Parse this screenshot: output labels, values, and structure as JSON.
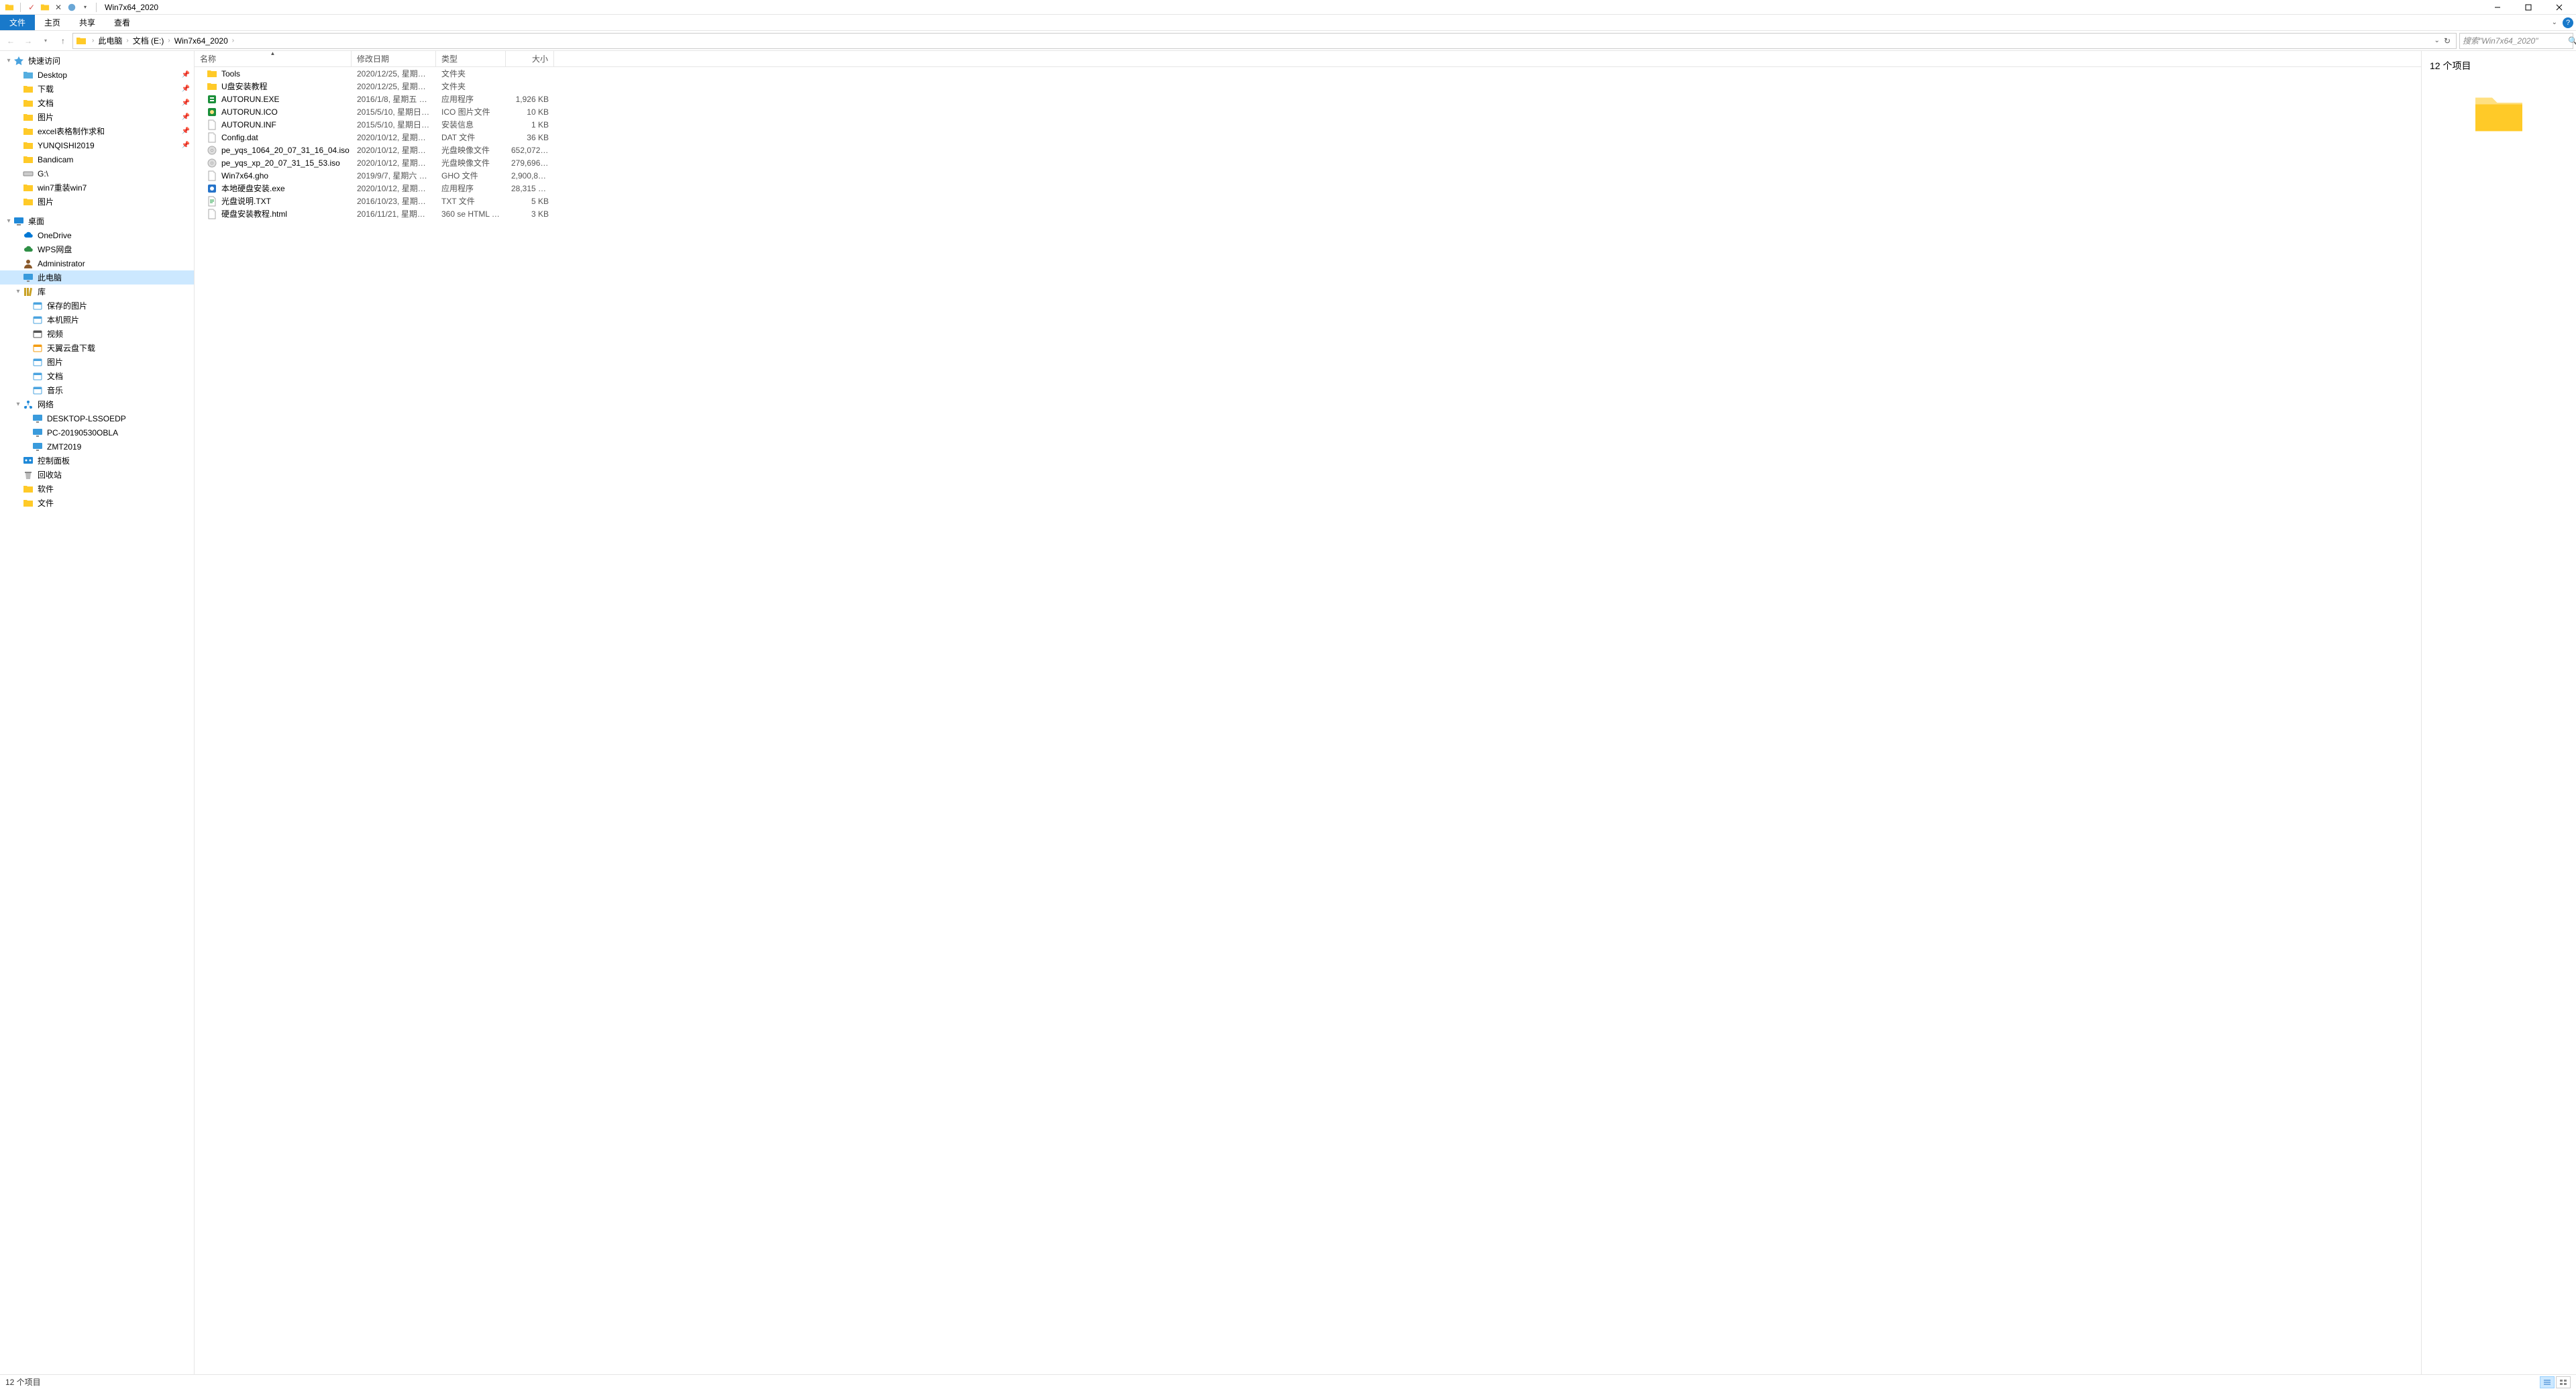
{
  "window": {
    "title": "Win7x64_2020",
    "min": "—",
    "max": "▭",
    "close": "✕"
  },
  "ribbon": {
    "tabs": [
      "文件",
      "主页",
      "共享",
      "查看"
    ]
  },
  "breadcrumb": [
    "此电脑",
    "文档 (E:)",
    "Win7x64_2020"
  ],
  "search": {
    "placeholder": "搜索\"Win7x64_2020\""
  },
  "columns": {
    "name": "名称",
    "date": "修改日期",
    "type": "类型",
    "size": "大小"
  },
  "sidebar": [
    {
      "label": "快速访问",
      "indent": 1,
      "icon": "star",
      "color": "#4aa3df",
      "chev": "▾"
    },
    {
      "label": "Desktop",
      "indent": 2,
      "icon": "folder",
      "color": "#55aee0",
      "pin": true
    },
    {
      "label": "下载",
      "indent": 2,
      "icon": "folder",
      "color": "#ffca28",
      "pin": true
    },
    {
      "label": "文档",
      "indent": 2,
      "icon": "folder",
      "color": "#ffca28",
      "pin": true
    },
    {
      "label": "图片",
      "indent": 2,
      "icon": "folder",
      "color": "#ffca28",
      "pin": true
    },
    {
      "label": "excel表格制作求和",
      "indent": 2,
      "icon": "folder",
      "color": "#ffca28",
      "pin": true
    },
    {
      "label": "YUNQISHI2019",
      "indent": 2,
      "icon": "folder",
      "color": "#ffca28",
      "pin": true
    },
    {
      "label": "Bandicam",
      "indent": 2,
      "icon": "folder",
      "color": "#ffca28"
    },
    {
      "label": "G:\\",
      "indent": 2,
      "icon": "drive",
      "color": "#888"
    },
    {
      "label": "win7重装win7",
      "indent": 2,
      "icon": "folder",
      "color": "#ffca28"
    },
    {
      "label": "图片",
      "indent": 2,
      "icon": "folder",
      "color": "#ffca28"
    },
    {
      "label": "桌面",
      "indent": 1,
      "icon": "desktop",
      "color": "#2089d8",
      "chev": "▾",
      "gapBefore": true
    },
    {
      "label": "OneDrive",
      "indent": 2,
      "icon": "cloud",
      "color": "#0078d4"
    },
    {
      "label": "WPS网盘",
      "indent": 2,
      "icon": "cloud",
      "color": "#2f8f46"
    },
    {
      "label": "Administrator",
      "indent": 2,
      "icon": "user",
      "color": "#8b5a2b"
    },
    {
      "label": "此电脑",
      "indent": 2,
      "icon": "pc",
      "color": "#3a9bdc",
      "selected": true
    },
    {
      "label": "库",
      "indent": 2,
      "icon": "library",
      "color": "#c9a227",
      "chev": "▾"
    },
    {
      "label": "保存的图片",
      "indent": 3,
      "icon": "lib",
      "color": "#4aa3df"
    },
    {
      "label": "本机照片",
      "indent": 3,
      "icon": "lib",
      "color": "#4aa3df"
    },
    {
      "label": "视频",
      "indent": 3,
      "icon": "lib",
      "color": "#555"
    },
    {
      "label": "天翼云盘下载",
      "indent": 3,
      "icon": "lib",
      "color": "#f39c12"
    },
    {
      "label": "图片",
      "indent": 3,
      "icon": "lib",
      "color": "#4aa3df"
    },
    {
      "label": "文档",
      "indent": 3,
      "icon": "lib",
      "color": "#4aa3df"
    },
    {
      "label": "音乐",
      "indent": 3,
      "icon": "lib",
      "color": "#4aa3df"
    },
    {
      "label": "网络",
      "indent": 2,
      "icon": "network",
      "color": "#2089d8",
      "chev": "▾"
    },
    {
      "label": "DESKTOP-LSSOEDP",
      "indent": 3,
      "icon": "pc",
      "color": "#3a9bdc"
    },
    {
      "label": "PC-20190530OBLA",
      "indent": 3,
      "icon": "pc",
      "color": "#3a9bdc"
    },
    {
      "label": "ZMT2019",
      "indent": 3,
      "icon": "pc",
      "color": "#3a9bdc"
    },
    {
      "label": "控制面板",
      "indent": 2,
      "icon": "control",
      "color": "#2089d8"
    },
    {
      "label": "回收站",
      "indent": 2,
      "icon": "recycle",
      "color": "#888"
    },
    {
      "label": "软件",
      "indent": 2,
      "icon": "folder",
      "color": "#ffca28"
    },
    {
      "label": "文件",
      "indent": 2,
      "icon": "folder",
      "color": "#ffca28"
    }
  ],
  "files": [
    {
      "name": "Tools",
      "date": "2020/12/25, 星期五 1...",
      "type": "文件夹",
      "size": "",
      "icon": "folder",
      "color": "#ffca28"
    },
    {
      "name": "U盘安装教程",
      "date": "2020/12/25, 星期五 1...",
      "type": "文件夹",
      "size": "",
      "icon": "folder",
      "color": "#ffca28"
    },
    {
      "name": "AUTORUN.EXE",
      "date": "2016/1/8, 星期五 04:...",
      "type": "应用程序",
      "size": "1,926 KB",
      "icon": "exe",
      "color": "#1b8f3a"
    },
    {
      "name": "AUTORUN.ICO",
      "date": "2015/5/10, 星期日 02...",
      "type": "ICO 图片文件",
      "size": "10 KB",
      "icon": "ico",
      "color": "#1b8f3a"
    },
    {
      "name": "AUTORUN.INF",
      "date": "2015/5/10, 星期日 02...",
      "type": "安装信息",
      "size": "1 KB",
      "icon": "inf",
      "color": "#888"
    },
    {
      "name": "Config.dat",
      "date": "2020/10/12, 星期一 1...",
      "type": "DAT 文件",
      "size": "36 KB",
      "icon": "file",
      "color": "#888"
    },
    {
      "name": "pe_yqs_1064_20_07_31_16_04.iso",
      "date": "2020/10/12, 星期一 1...",
      "type": "光盘映像文件",
      "size": "652,072 KB",
      "icon": "iso",
      "color": "#888"
    },
    {
      "name": "pe_yqs_xp_20_07_31_15_53.iso",
      "date": "2020/10/12, 星期一 1...",
      "type": "光盘映像文件",
      "size": "279,696 KB",
      "icon": "iso",
      "color": "#888"
    },
    {
      "name": "Win7x64.gho",
      "date": "2019/9/7, 星期六 19:...",
      "type": "GHO 文件",
      "size": "2,900,813...",
      "icon": "file",
      "color": "#888"
    },
    {
      "name": "本地硬盘安装.exe",
      "date": "2020/10/12, 星期一 1...",
      "type": "应用程序",
      "size": "28,315 KB",
      "icon": "exe2",
      "color": "#2573c9"
    },
    {
      "name": "光盘说明.TXT",
      "date": "2016/10/23, 星期日 0...",
      "type": "TXT 文件",
      "size": "5 KB",
      "icon": "txt",
      "color": "#2ea44f"
    },
    {
      "name": "硬盘安装教程.html",
      "date": "2016/11/21, 星期一 2...",
      "type": "360 se HTML Do...",
      "size": "3 KB",
      "icon": "html",
      "color": "#888"
    }
  ],
  "details": {
    "title": "12 个项目"
  },
  "status": {
    "text": "12 个项目"
  }
}
